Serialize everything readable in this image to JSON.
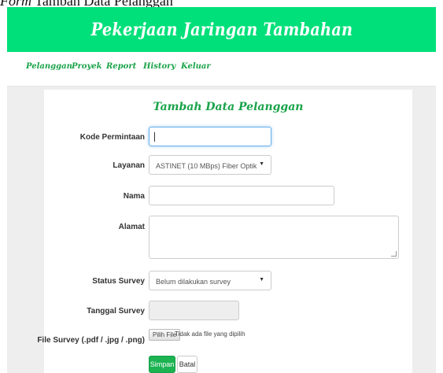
{
  "caption": {
    "prefix": "Form",
    "text": " Tambah Data Pelanggan"
  },
  "header": {
    "title": "Pekerjaan Jaringan Tambahan"
  },
  "nav": {
    "items": [
      "Pelanggan",
      "Proyek",
      "Report",
      "History",
      "Keluar"
    ]
  },
  "form": {
    "title": "Tambah Data Pelanggan",
    "kode_label": "Kode Permintaan",
    "layanan_label": "Layanan",
    "layanan_value": "ASTINET (10 MBps) Fiber Optik",
    "nama_label": "Nama",
    "alamat_label": "Alamat",
    "status_label": "Status Survey",
    "status_value": "Belum dilakukan survey",
    "tanggal_label": "Tanggal Survey",
    "file_label": "File Survey (.pdf / .jpg / .png)",
    "file_button": "Pilih File",
    "file_status": "Tidak ada file yang dipilih",
    "save_label": "Simpan",
    "cancel_label": "Batal"
  },
  "colors": {
    "brand_green": "#00e07a",
    "nav_green": "#1aa34a",
    "button_green": "#1cb352"
  }
}
